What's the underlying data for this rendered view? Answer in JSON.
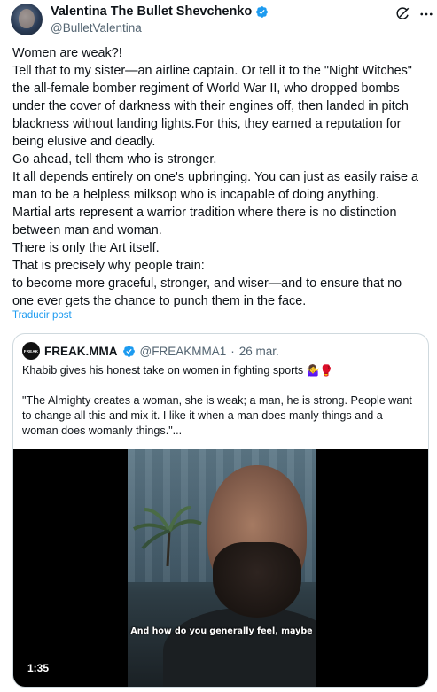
{
  "author": {
    "display_name": "Valentina The Bullet Shevchenko",
    "handle": "@BulletValentina",
    "verified": true
  },
  "post": {
    "lines": [
      "Women are weak?!",
      "Tell that to my sister—an airline captain. Or tell it to the \"Night Witches\"",
      "the all-female bomber regiment of World War II, who dropped bombs",
      "under the cover of darkness with their engines off, then landed in pitch",
      "blackness without landing lights.For this, they earned a reputation for",
      "being elusive and deadly.",
      "Go ahead, tell them who is stronger.",
      "It all depends entirely on one's upbringing. You can just as easily raise a",
      "man to be a helpless milksop who is incapable of doing anything.",
      "Martial arts represent a warrior tradition where there is no distinction",
      "between man and woman.",
      "There is only the Art itself.",
      "That is precisely why people train:",
      "to become more graceful, stronger, and wiser—and to ensure that no",
      "one ever gets the chance to punch them in the face."
    ],
    "translate_label": "Traducir post"
  },
  "quote": {
    "avatar_text": "FREAK",
    "display_name": "FREAK.MMA",
    "handle": "@FREAKMMA1",
    "separator": "·",
    "date": "26 mar.",
    "verified": true,
    "headline": "Khabib gives his honest take on women in fighting sports",
    "headline_emojis": "🤷‍♀️🥊",
    "quote_lines": [
      "\"The Almighty creates a woman, she is weak; a man, he is strong. People want",
      "to change all this and mix it. I like it when a man does manly things and a",
      "woman does womanly things.\"..."
    ],
    "video": {
      "subtitle": "And how do you generally feel, maybe",
      "duration": "1:35"
    }
  },
  "icons": {
    "verified": "verified-badge-icon",
    "grok": "grok-icon",
    "more": "more-options-icon"
  },
  "colors": {
    "verified": "#1d9bf0",
    "link": "#1d9bf0",
    "secondary_text": "#536471",
    "border": "#cfd9de"
  }
}
